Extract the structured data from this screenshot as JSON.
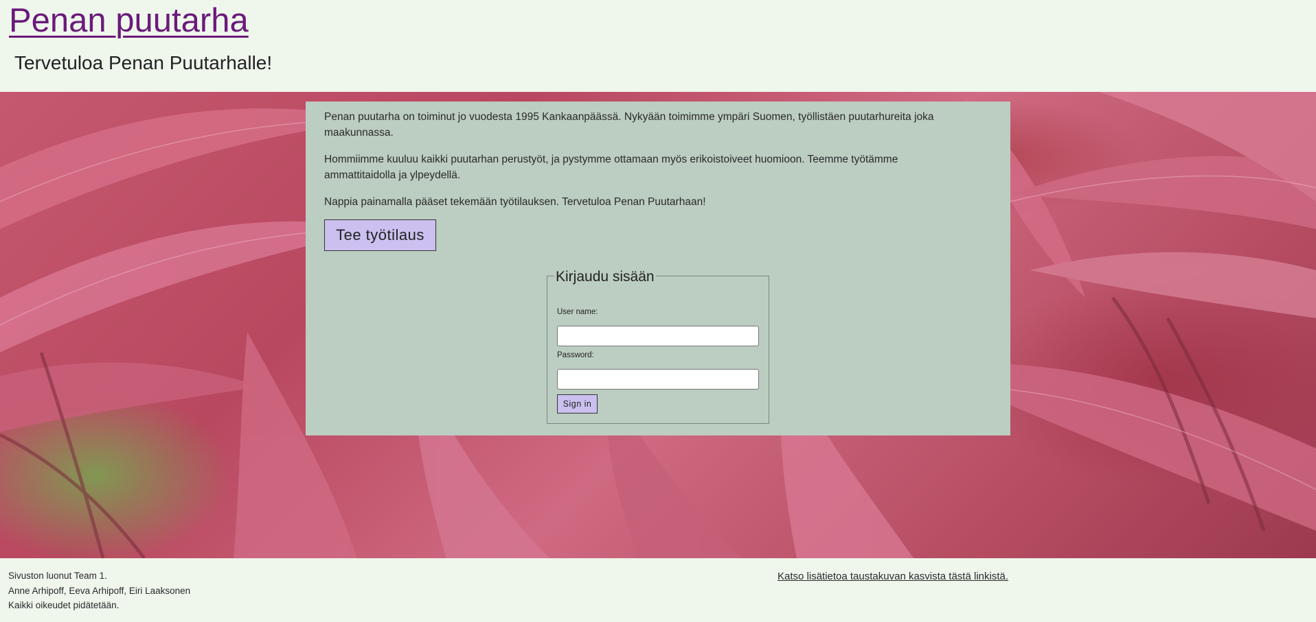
{
  "header": {
    "site_title": "Penan puutarha",
    "welcome": "Tervetuloa Penan Puutarhalle!"
  },
  "main": {
    "paragraphs": [
      "Penan puutarha on toiminut jo vuodesta 1995 Kankaanpäässä. Nykyään toimimme ympäri Suomen, työllistäen puutarhureita joka maakunnassa.",
      "Hommiimme kuuluu kaikki puutarhan perustyöt, ja pystymme ottamaan myös erikoistoiveet huomioon. Teemme työtämme ammattitaidolla ja ylpeydellä.",
      "Nappia painamalla pääset tekemään työtilauksen. Tervetuloa Penan Puutarhaan!"
    ],
    "order_button": "Tee työtilaus"
  },
  "login": {
    "legend": "Kirjaudu sisään",
    "username_label": "User name:",
    "username_value": "",
    "password_label": "Password:",
    "password_value": "",
    "submit_label": "Sign in"
  },
  "footer": {
    "lines": [
      "Sivuston luonut Team 1.",
      "Anne Arhipoff, Eeva Arhipoff, Eiri Laaksonen",
      "Kaikki oikeudet pidätetään."
    ],
    "link_text": "Katso lisätietoa taustakuvan kasvista tästä linkistä."
  },
  "colors": {
    "page_background": "#eff6ec",
    "title_link": "#6a1a7a",
    "panel_background": "#bccdc1",
    "button_background": "#cbc0ef",
    "hero_leaf": "#c5586f"
  },
  "hero": {
    "image_description_icon": "red-maple-leaves-background-image"
  }
}
